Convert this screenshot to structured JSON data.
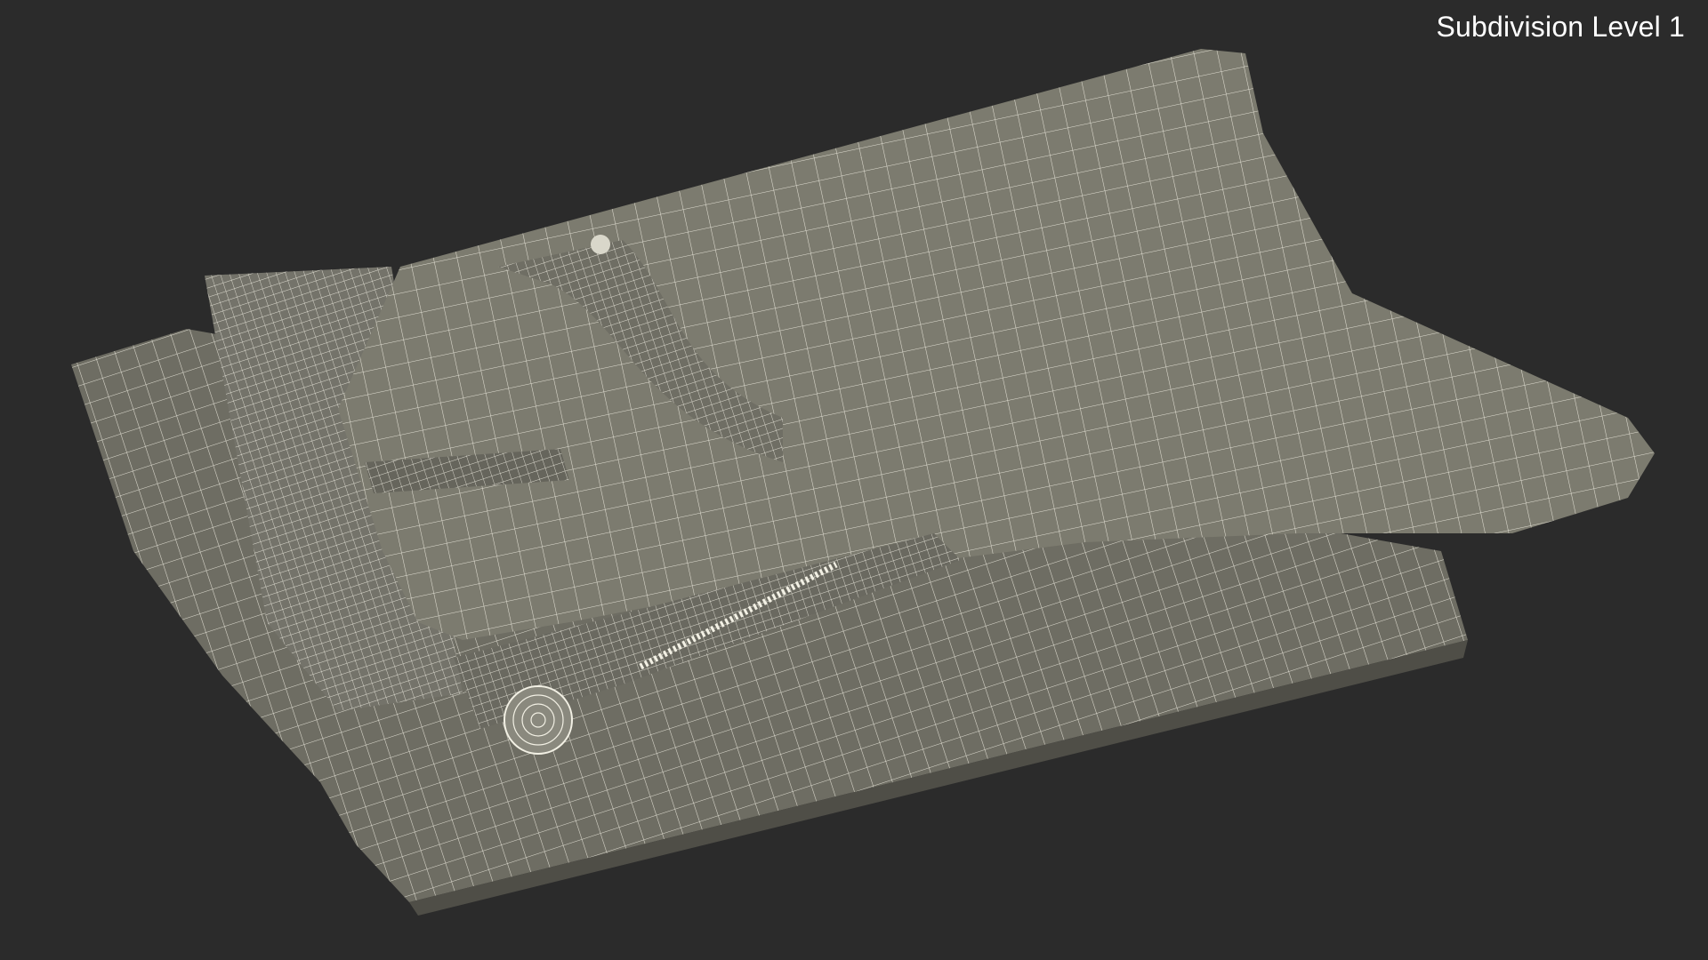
{
  "viewport": {
    "label": "Subdivision Level 1"
  },
  "scene": {
    "subject": "folded-trousers-wireframe-icon",
    "background_color": "#2b2b2b",
    "surface_color": "#7c7b6f",
    "surface_dark_color": "#5f5e55",
    "wire_color": "#f2f0e4"
  }
}
